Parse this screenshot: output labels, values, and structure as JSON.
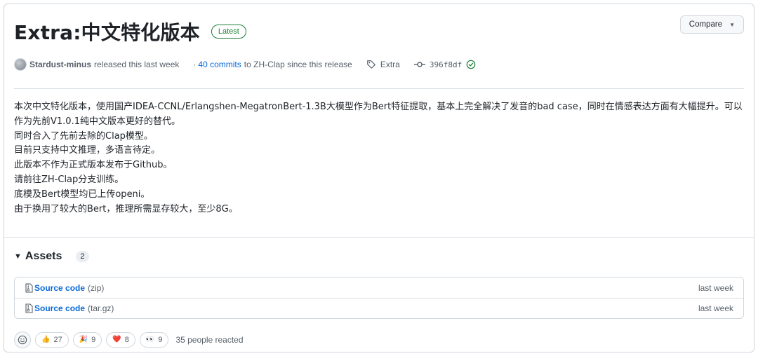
{
  "release": {
    "title": "Extra:中文特化版本",
    "badge": "Latest",
    "compare_label": "Compare",
    "author": "Stardust-minus",
    "released_text": "released this last week",
    "commits_prefix": "·",
    "commits_link": "40 commits",
    "commits_suffix": "to ZH-Clap since this release",
    "tag": "Extra",
    "commit_sha": "396f8df"
  },
  "body": {
    "lines": [
      "本次中文特化版本，使用国产IDEA-CCNL/Erlangshen-MegatronBert-1.3B大模型作为Bert特征提取，基本上完全解决了发音的bad case，同时在情感表达方面有大幅提升。可以作为先前V1.0.1纯中文版本更好的替代。",
      "同时合入了先前去除的Clap模型。",
      "目前只支持中文推理，多语言待定。",
      "此版本不作为正式版本发布于Github。",
      "请前往ZH-Clap分支训练。",
      "底模及Bert模型均已上传openi。",
      "由于换用了较大的Bert，推理所需显存较大，至少8G。"
    ]
  },
  "assets": {
    "title": "Assets",
    "count": "2",
    "items": [
      {
        "name": "Source code",
        "ext": "(zip)",
        "time": "last week"
      },
      {
        "name": "Source code",
        "ext": "(tar.gz)",
        "time": "last week"
      }
    ]
  },
  "reactions": {
    "items": [
      {
        "emoji": "👍",
        "count": "27"
      },
      {
        "emoji": "🎉",
        "count": "9"
      },
      {
        "emoji": "❤️",
        "count": "8"
      },
      {
        "emoji": "👀",
        "count": "9"
      }
    ],
    "summary": "35 people reacted"
  },
  "colors": {
    "link": "#0969da",
    "success": "#1a7f37",
    "border": "#d0d7de",
    "muted": "#57606a"
  }
}
